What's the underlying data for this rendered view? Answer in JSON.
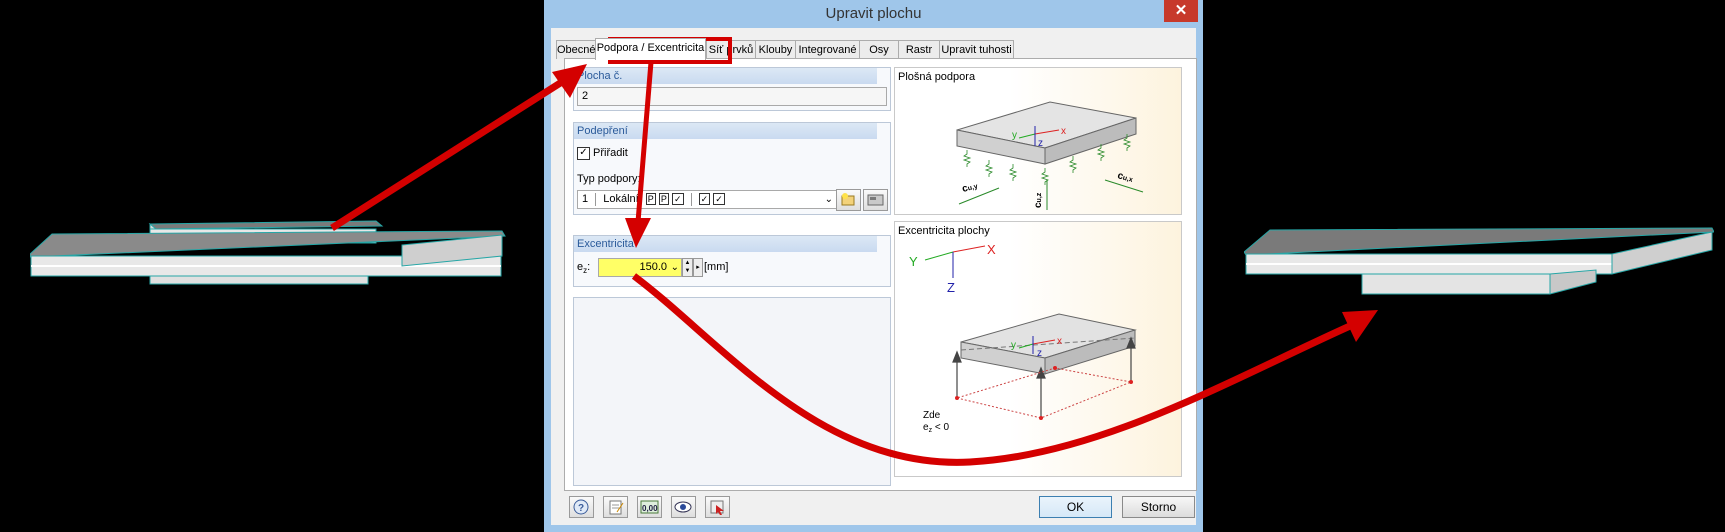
{
  "dialog": {
    "title": "Upravit plochu",
    "close_glyph": "✕",
    "tabs": [
      {
        "label": "Obecné"
      },
      {
        "label": "Podpora / Excentricita",
        "active": true
      },
      {
        "label": "Síť prvků"
      },
      {
        "label": "Klouby"
      },
      {
        "label": "Integrované"
      },
      {
        "label": "Osy"
      },
      {
        "label": "Rastr"
      },
      {
        "label": "Upravit tuhosti"
      }
    ]
  },
  "surface": {
    "label": "Plocha č.",
    "value": "2"
  },
  "support": {
    "header": "Podepření",
    "assign_label": "Přiřadit",
    "assign_checked": true,
    "type_label": "Typ podpory:",
    "type_number": "1",
    "type_name": "Lokální",
    "type_flags": [
      "P",
      "P",
      "✓",
      "✓",
      "✓"
    ]
  },
  "eccentricity": {
    "header": "Excentricita",
    "ez_label": "e",
    "ez_sub": "z",
    "ez_value": "150.0",
    "unit": "[mm]"
  },
  "images": {
    "surface_support": {
      "title": "Plošná podpora",
      "axes": [
        "y",
        "x",
        "z"
      ],
      "labels": [
        "c",
        "u,y",
        "c",
        "u,z",
        "c",
        "u,x"
      ]
    },
    "surface_eccentricity": {
      "title": "Excentricita plochy",
      "axes": [
        "Y",
        "X",
        "Z"
      ],
      "small_axes": [
        "y",
        "x",
        "z"
      ],
      "note_line1": "Zde",
      "note_line2_a": "e",
      "note_line2_sub": "z",
      "note_line2_b": " < 0"
    }
  },
  "footer": {
    "ok": "OK",
    "cancel": "Storno",
    "units_icon_text": "0,00"
  },
  "colors": {
    "highlight": "#d40000",
    "field_yellow": "#ffff66",
    "plate_gray": "#b8b8b8",
    "plate_edge": "#26a6a6"
  }
}
